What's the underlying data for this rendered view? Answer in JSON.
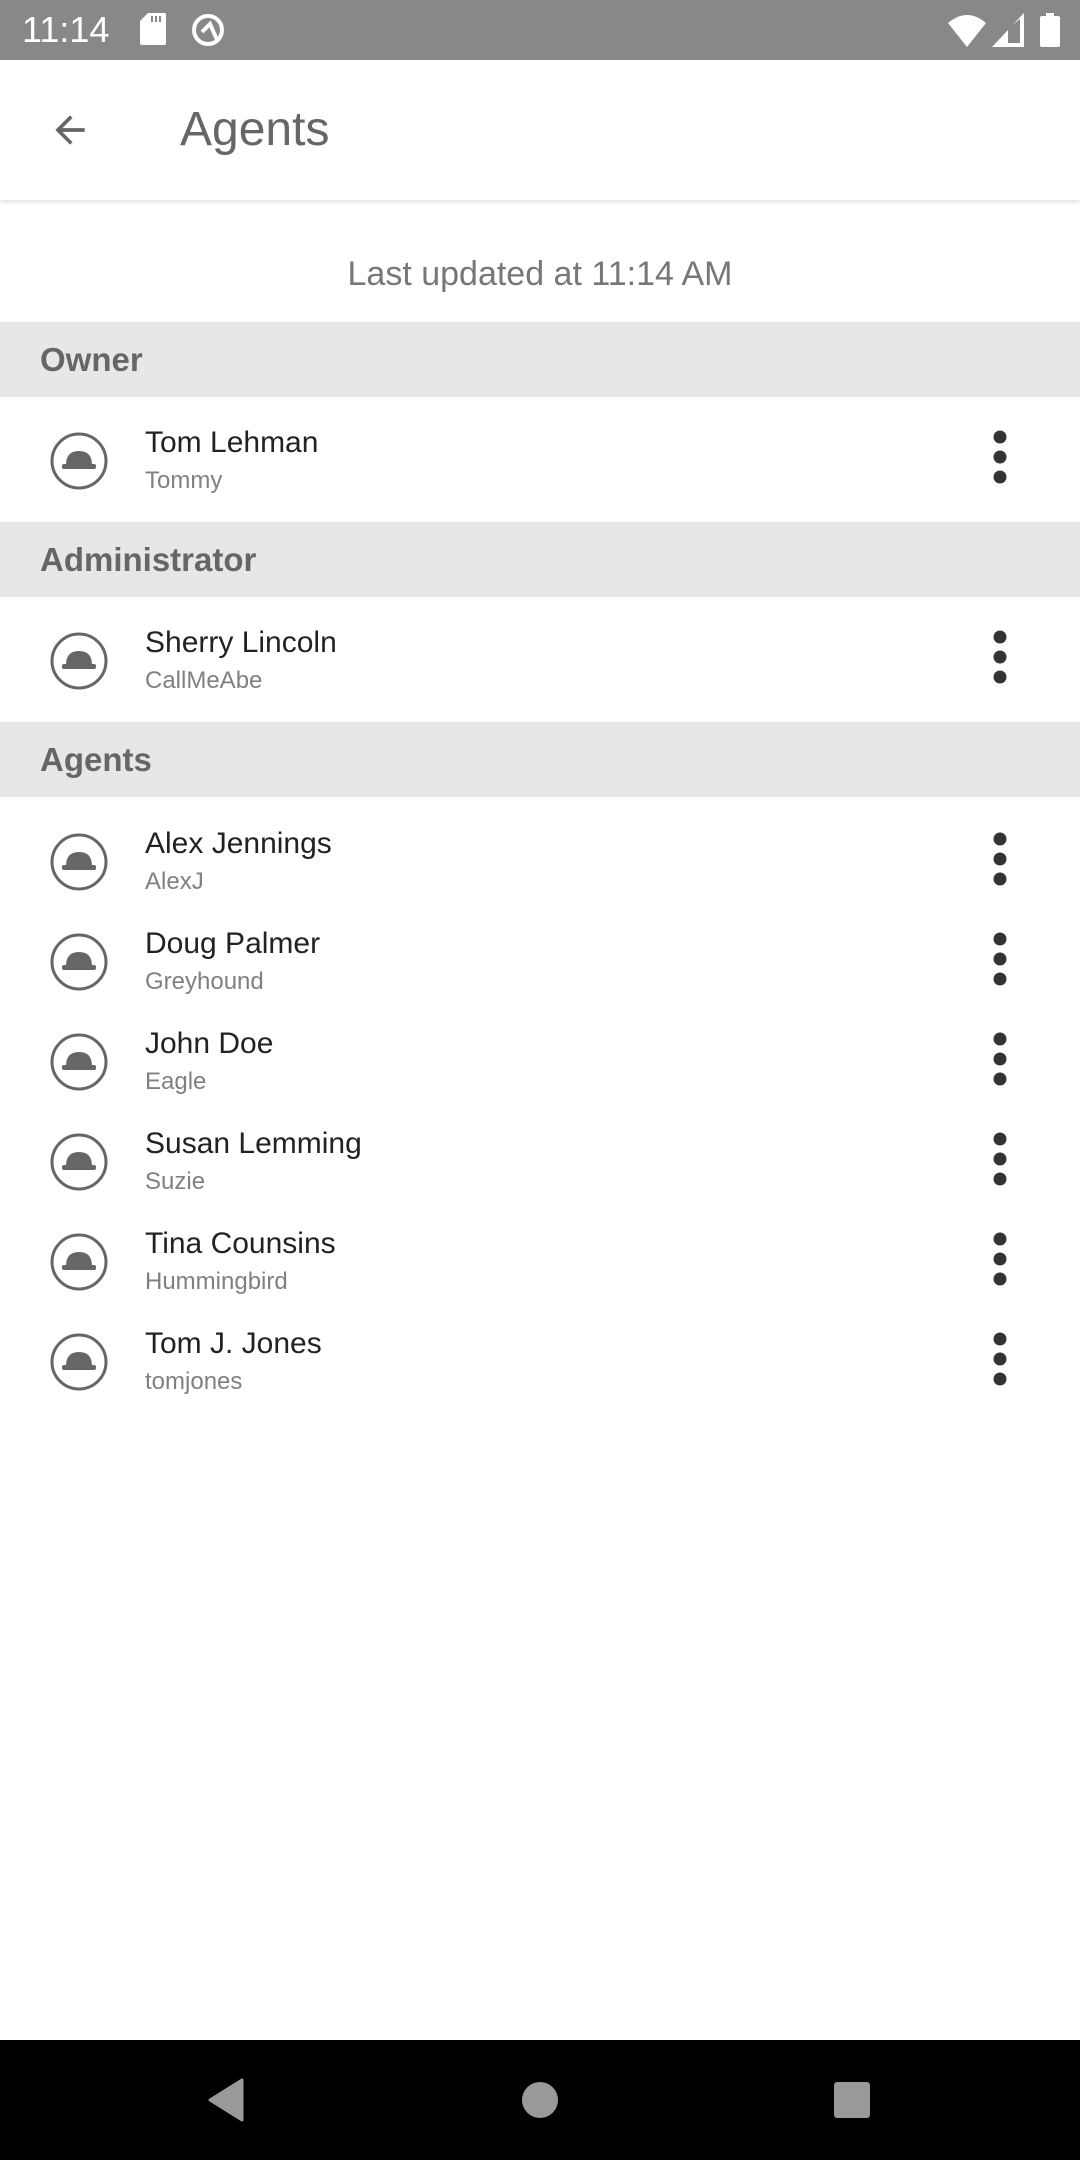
{
  "status_bar": {
    "time": "11:14",
    "icons": [
      "sd-card-icon",
      "q-logo-icon",
      "wifi-icon",
      "signal-icon",
      "battery-icon"
    ]
  },
  "app_bar": {
    "back_icon": "arrow-back-icon",
    "title": "Agents"
  },
  "last_updated": "Last updated at 11:14 AM",
  "sections": [
    {
      "title": "Owner",
      "members": [
        {
          "name": "Tom Lehman",
          "nickname": "Tommy"
        }
      ]
    },
    {
      "title": "Administrator",
      "members": [
        {
          "name": "Sherry Lincoln",
          "nickname": "CallMeAbe"
        }
      ]
    },
    {
      "title": "Agents",
      "members": [
        {
          "name": "Alex Jennings",
          "nickname": "AlexJ"
        },
        {
          "name": "Doug Palmer",
          "nickname": "Greyhound"
        },
        {
          "name": "John Doe",
          "nickname": "Eagle"
        },
        {
          "name": "Susan Lemming",
          "nickname": "Suzie"
        },
        {
          "name": "Tina Counsins",
          "nickname": "Hummingbird"
        },
        {
          "name": "Tom J. Jones",
          "nickname": "tomjones"
        }
      ]
    }
  ],
  "row_icons": {
    "avatar": "bowler-hat-icon",
    "menu": "more-vertical-icon"
  },
  "nav_bar": {
    "buttons": [
      "nav-back-icon",
      "nav-home-icon",
      "nav-recents-icon"
    ]
  },
  "colors": {
    "status_bar": "#888888",
    "section_header_bg": "#e8e7e8",
    "header_text": "#666666",
    "name_text": "#222222",
    "nickname_text": "#808080"
  }
}
